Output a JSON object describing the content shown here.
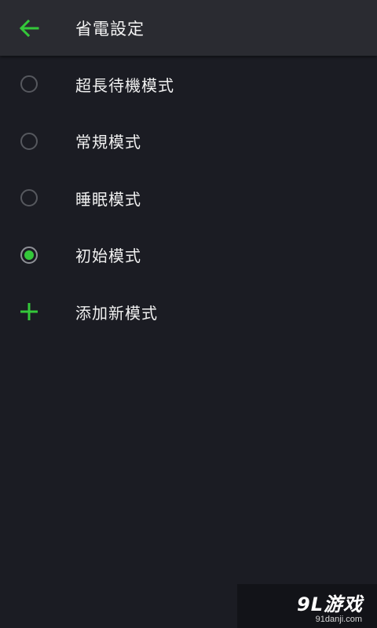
{
  "app_bar": {
    "title": "省電設定",
    "back_icon": "arrow-left-icon",
    "accent_color": "#34c83a"
  },
  "modes": [
    {
      "label": "超長待機模式",
      "selected": false
    },
    {
      "label": "常規模式",
      "selected": false
    },
    {
      "label": "睡眠模式",
      "selected": false
    },
    {
      "label": "初始模式",
      "selected": true
    }
  ],
  "add_mode": {
    "label": "添加新模式",
    "icon": "plus-icon"
  },
  "watermark": {
    "logo": "9L游戏",
    "url": "91danji.com"
  }
}
